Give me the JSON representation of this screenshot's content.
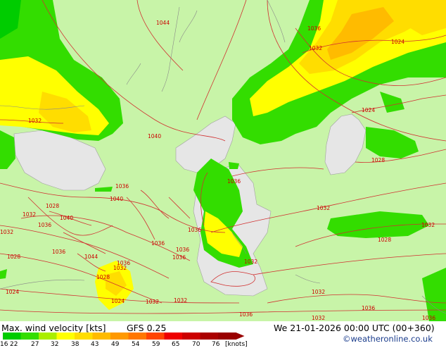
{
  "map": {
    "isobar_labels": [
      "1044",
      "1036",
      "1032",
      "1024",
      "1032",
      "1024",
      "1040",
      "1036",
      "1036",
      "1040",
      "1028",
      "1032",
      "1040",
      "1036",
      "1036",
      "1036",
      "1028",
      "1032",
      "1032",
      "1044",
      "1036",
      "1032",
      "1028",
      "1036",
      "1032",
      "1036",
      "1036",
      "1032",
      "1028",
      "1032",
      "1024",
      "1024",
      "1032",
      "1032",
      "1036",
      "1036",
      "1028",
      "1032",
      "1036"
    ]
  },
  "footer": {
    "title": "Max. wind velocity [kts]",
    "model": "GFS 0.25",
    "datetime": "We 21-01-2026 00:00 UTC (00+360)",
    "credit": "©weatheronline.co.uk",
    "scale_ticks": [
      "16",
      "22",
      "27",
      "32",
      "38",
      "43",
      "49",
      "54",
      "59",
      "65",
      "70",
      "76"
    ],
    "scale_unit": "[knots]",
    "scale_colors": [
      "#00cc00",
      "#33dd00",
      "#aaee00",
      "#ffff00",
      "#ffdd00",
      "#ffbb00",
      "#ff9900",
      "#ff7700",
      "#ff4400",
      "#ee0000",
      "#cc0000",
      "#aa0000",
      "#990000"
    ]
  }
}
